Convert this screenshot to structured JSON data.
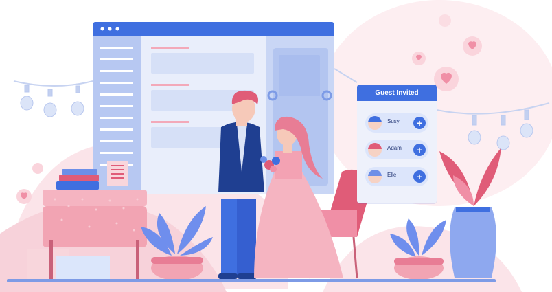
{
  "guest_panel": {
    "title": "Guest Invited",
    "guests": [
      {
        "name": "Susy",
        "add_icon": "plus-icon"
      },
      {
        "name": "Adam",
        "add_icon": "plus-icon"
      },
      {
        "name": "Elle",
        "add_icon": "plus-icon"
      }
    ]
  },
  "colors": {
    "primary_blue": "#3f6fe0",
    "pink": "#f2a4b3",
    "light_pink": "#fbe6ea",
    "navy": "#1f3f91"
  }
}
